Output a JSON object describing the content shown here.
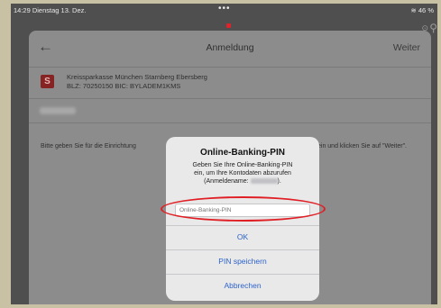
{
  "status_bar": {
    "time_date": "14:29 Dienstag 13. Dez.",
    "dots": "•••",
    "right": "46 %"
  },
  "nav": {
    "title": "Anmeldung",
    "next_label": "Weiter",
    "back_icon": "arrow-left-icon"
  },
  "bank": {
    "logo_glyph": "S",
    "name": "Kreissparkasse München Starnberg Ebersberg",
    "codes": "BLZ: 70250150   BIC: BYLADEM1KMS"
  },
  "instruction": {
    "left": "Bitte geben Sie für die Einrichtung",
    "right": "ein und klicken Sie auf \"Weiter\"."
  },
  "alert": {
    "title": "Online-Banking-PIN",
    "message_line1": "Geben Sie Ihre Online-Banking-PIN",
    "message_line2": "ein, um Ihre Kontodaten abzurufen",
    "message_line3_prefix": "(Anmeldename:",
    "message_line3_suffix": ").",
    "pin_placeholder": "Online-Banking-PIN",
    "ok_label": "OK",
    "save_label": "PIN speichern",
    "cancel_label": "Abbrechen"
  },
  "colors": {
    "accent_blue": "#2e63c9",
    "highlight_red": "#e01f25"
  }
}
